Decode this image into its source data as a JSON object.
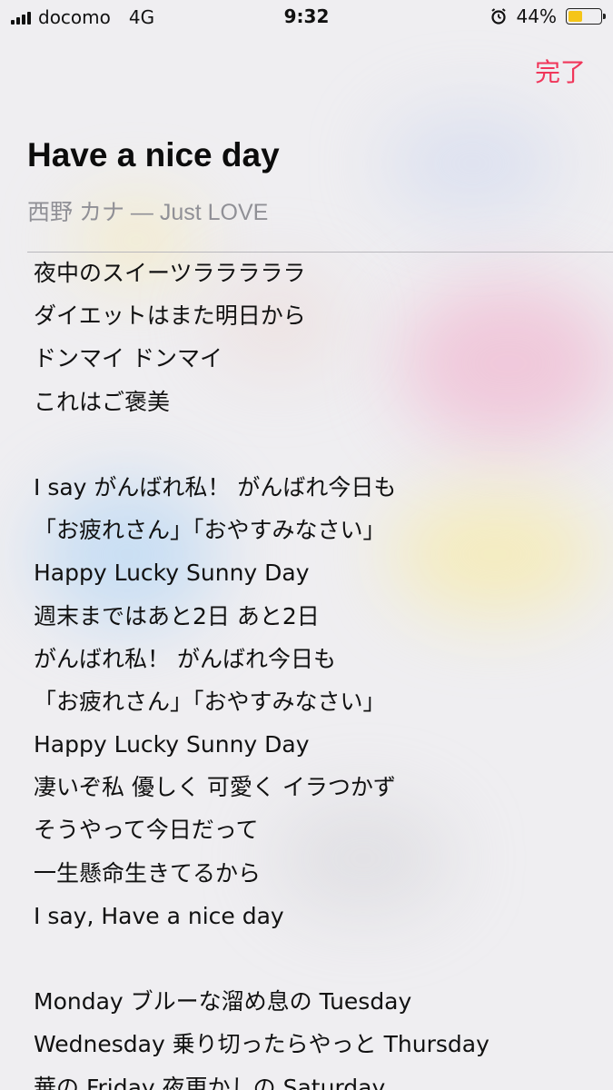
{
  "status_bar": {
    "carrier": "docomo",
    "network": "4G",
    "time": "9:32",
    "battery_percent": "44%",
    "battery_level": 0.44,
    "battery_color": "#f5c518"
  },
  "nav": {
    "done_label": "完了",
    "accent_color": "#f0365a"
  },
  "song": {
    "title": "Have a nice day",
    "subtitle": "西野 カナ — Just LOVE"
  },
  "lyrics": [
    "夜中のスイーツラララララ",
    "ダイエットはまた明日から",
    "ドンマイ ドンマイ",
    "これはご褒美",
    "",
    "I say がんばれ私！ がんばれ今日も",
    "「お疲れさん」「おやすみなさい」",
    "Happy Lucky Sunny Day",
    "週末まではあと2日 あと2日",
    "がんばれ私！ がんばれ今日も",
    "「お疲れさん」「おやすみなさい」",
    "Happy Lucky Sunny Day",
    "凄いぞ私 優しく 可愛く イラつかず",
    "そうやって今日だって",
    "一生懸命生きてるから",
    "I say, Have a nice day",
    "",
    "Monday ブルーな溜め息の Tuesday",
    "Wednesday 乗り切ったらやっと Thursday",
    "華の Friday 夜更かしの Saturday"
  ]
}
